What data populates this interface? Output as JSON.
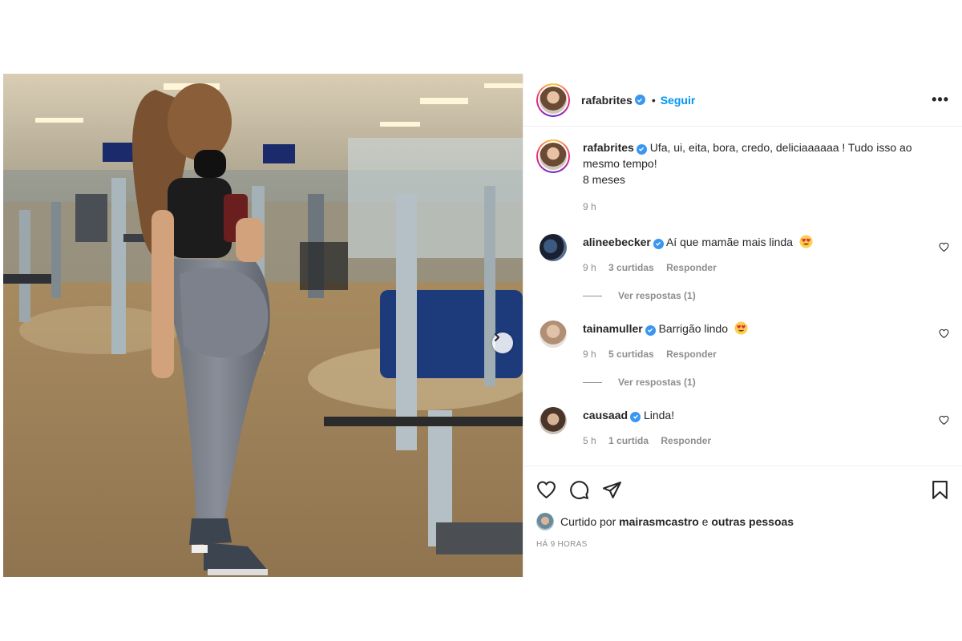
{
  "post": {
    "author": "rafabrites",
    "follow_label": "Seguir",
    "separator": "•",
    "more_label": "•••",
    "caption_line1": "Ufa, ui, eita, bora, credo, deliciaaaaaa ! Tudo isso ao mesmo tempo!",
    "caption_line2": "8 meses",
    "caption_time": "9 h"
  },
  "comments": [
    {
      "user": "alineebecker",
      "text": "Aí que mamãe mais linda",
      "time": "9 h",
      "likes": "3 curtidas",
      "reply_label": "Responder",
      "view_replies": "Ver respostas (1)"
    },
    {
      "user": "tainamuller",
      "text": "Barrigão lindo",
      "time": "9 h",
      "likes": "5 curtidas",
      "reply_label": "Responder",
      "view_replies": "Ver respostas (1)"
    },
    {
      "user": "causaad",
      "text": "Linda!",
      "time": "5 h",
      "likes": "1 curtida",
      "reply_label": "Responder"
    }
  ],
  "likes": {
    "prefix": "Curtido por",
    "user": "mairasmcastro",
    "conj": "e",
    "others": "outras pessoas"
  },
  "timestamp": "HÁ 9 HORAS",
  "colors": {
    "link_blue": "#0095f6",
    "verified_blue": "#3897f0",
    "muted": "#8e8e8e"
  },
  "icons": [
    "heart-icon",
    "comment-icon",
    "share-icon",
    "bookmark-icon",
    "verified-icon",
    "chevron-right-icon",
    "more-icon"
  ]
}
